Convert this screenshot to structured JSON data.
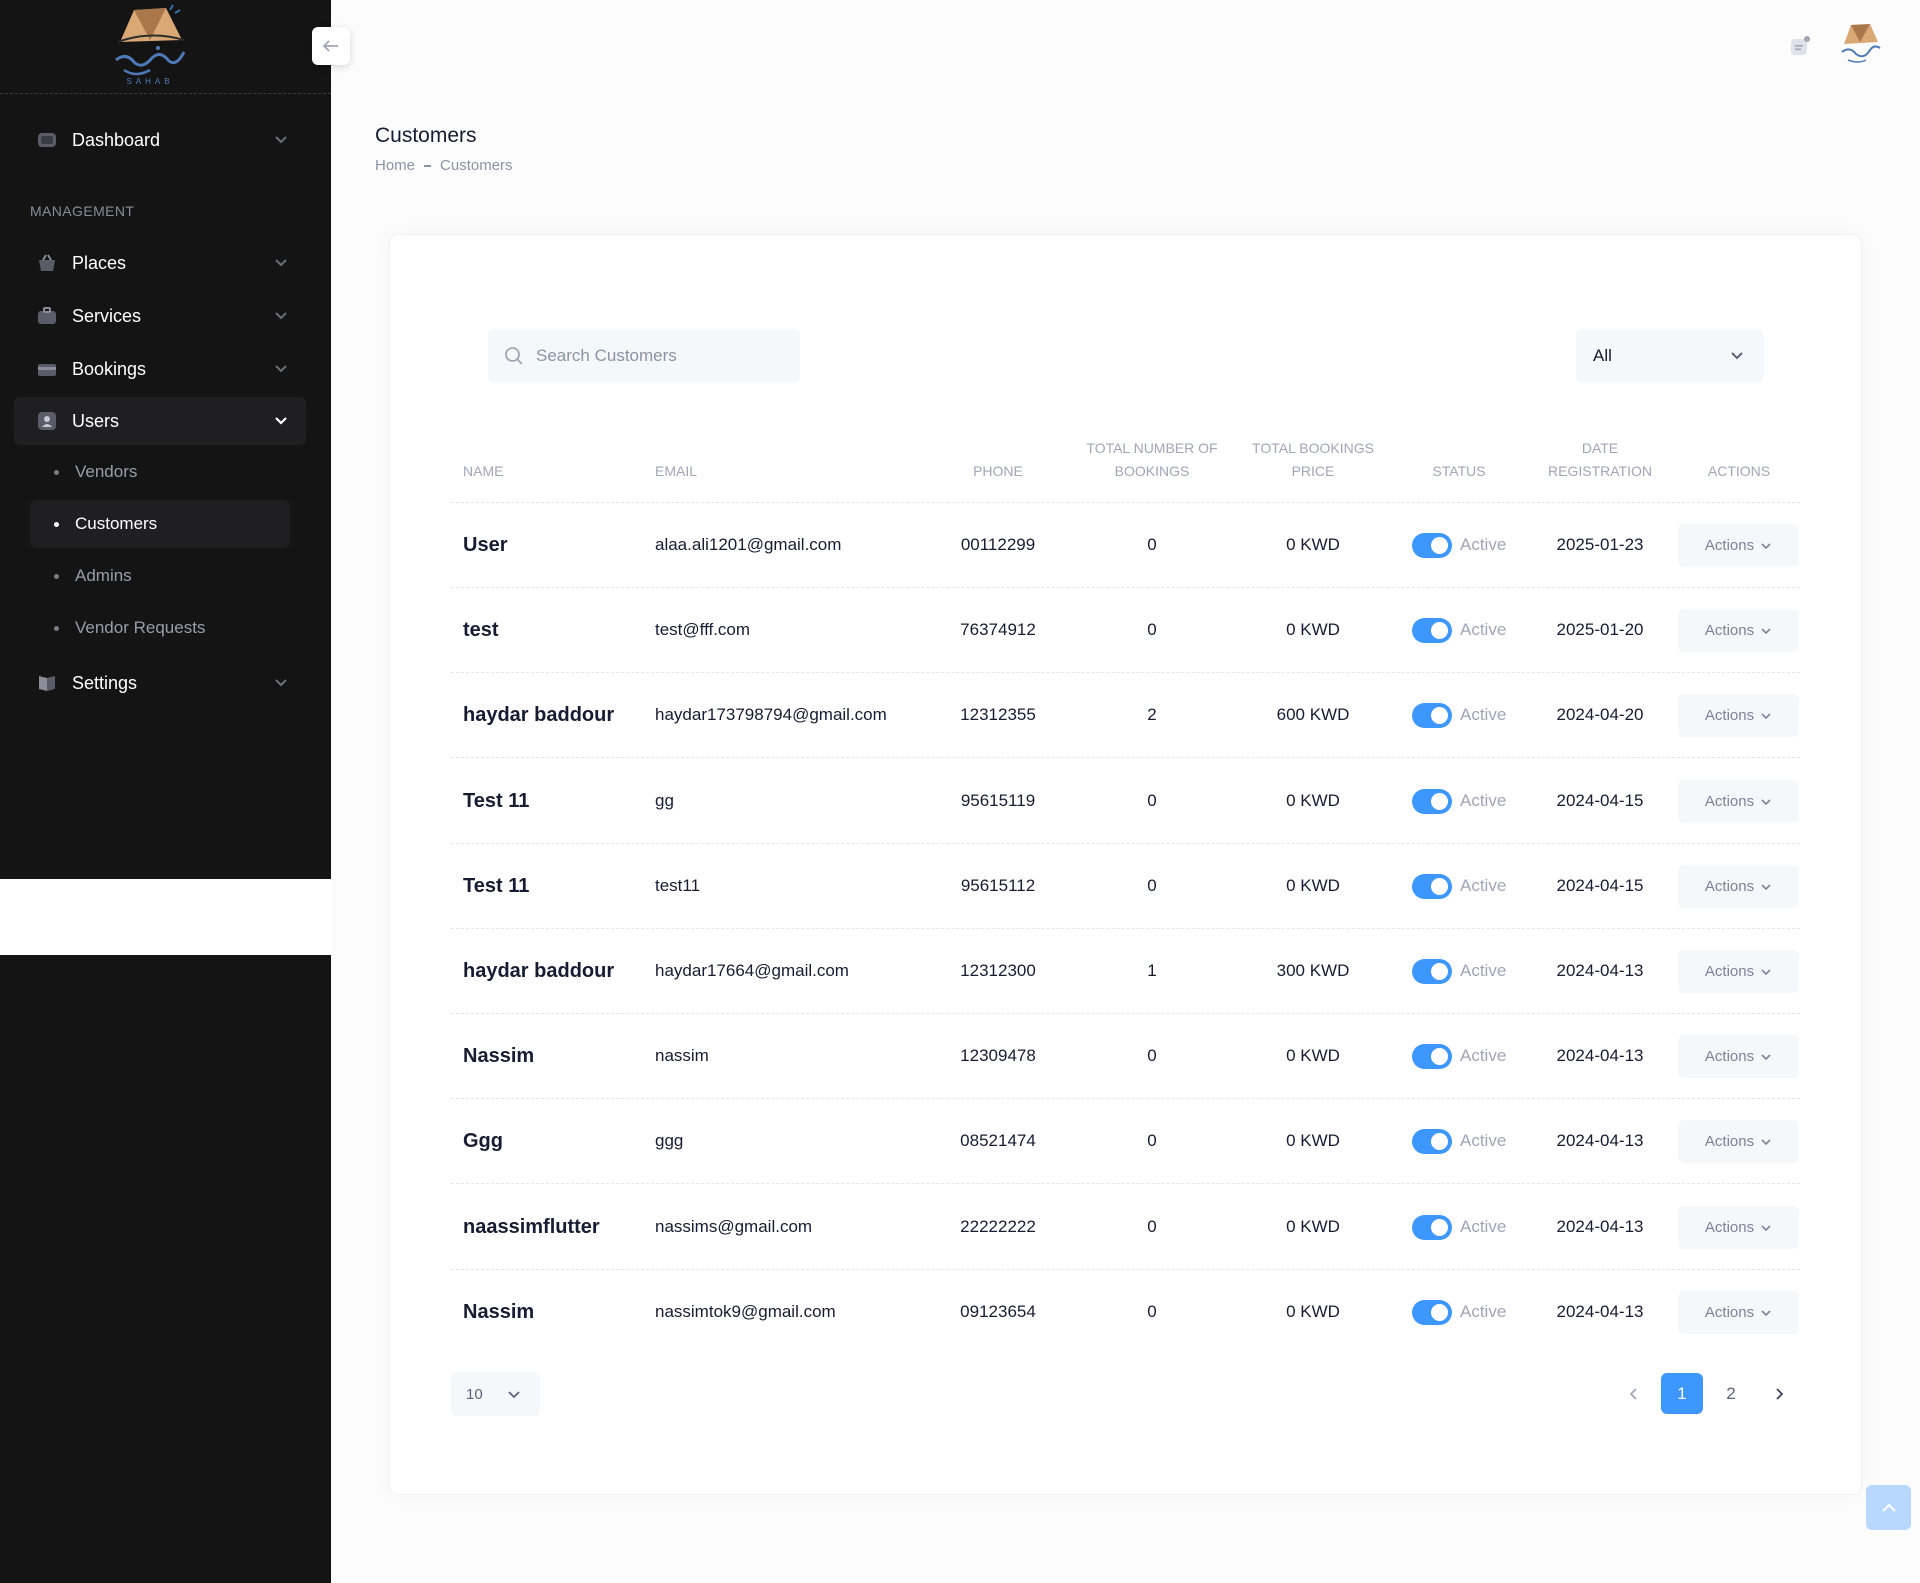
{
  "brand": {
    "logo_text": "سحاب",
    "logo_sub": "SAHAB"
  },
  "sidebar": {
    "section_label": "MANAGEMENT",
    "items": [
      {
        "label": "Dashboard",
        "icon": "dashboard-icon"
      },
      {
        "label": "Places",
        "icon": "basket-icon"
      },
      {
        "label": "Services",
        "icon": "briefcase-icon"
      },
      {
        "label": "Bookings",
        "icon": "wallet-icon"
      },
      {
        "label": "Users",
        "icon": "user-icon"
      },
      {
        "label": "Settings",
        "icon": "book-icon"
      }
    ],
    "users_sub": [
      {
        "label": "Vendors"
      },
      {
        "label": "Customers"
      },
      {
        "label": "Admins"
      },
      {
        "label": "Vendor Requests"
      }
    ]
  },
  "page": {
    "title": "Customers",
    "breadcrumb": [
      "Home",
      "Customers"
    ]
  },
  "search": {
    "placeholder": "Search Customers"
  },
  "filter": {
    "selected": "All"
  },
  "table": {
    "headers": {
      "name": "NAME",
      "email": "EMAIL",
      "phone": "PHONE",
      "bookings_l1": "TOTAL NUMBER OF",
      "bookings_l2": "BOOKINGS",
      "price_l1": "TOTAL BOOKINGS",
      "price_l2": "PRICE",
      "status": "STATUS",
      "date_l1": "DATE",
      "date_l2": "REGISTRATION",
      "actions": "ACTIONS"
    },
    "rows": [
      {
        "name": "User",
        "email": "alaa.ali1201@gmail.com",
        "phone": "00112299",
        "bookings": "0",
        "price": "0 KWD",
        "status": "Active",
        "date": "2025-01-23",
        "action": "Actions"
      },
      {
        "name": "test",
        "email": "test@fff.com",
        "phone": "76374912",
        "bookings": "0",
        "price": "0 KWD",
        "status": "Active",
        "date": "2025-01-20",
        "action": "Actions"
      },
      {
        "name": "haydar baddour",
        "email": "haydar173798794@gmail.com",
        "phone": "12312355",
        "bookings": "2",
        "price": "600 KWD",
        "status": "Active",
        "date": "2024-04-20",
        "action": "Actions"
      },
      {
        "name": "Test 11",
        "email": "gg",
        "phone": "95615119",
        "bookings": "0",
        "price": "0 KWD",
        "status": "Active",
        "date": "2024-04-15",
        "action": "Actions"
      },
      {
        "name": "Test 11",
        "email": "test11",
        "phone": "95615112",
        "bookings": "0",
        "price": "0 KWD",
        "status": "Active",
        "date": "2024-04-15",
        "action": "Actions"
      },
      {
        "name": "haydar baddour",
        "email": "haydar17664@gmail.com",
        "phone": "12312300",
        "bookings": "1",
        "price": "300 KWD",
        "status": "Active",
        "date": "2024-04-13",
        "action": "Actions"
      },
      {
        "name": "Nassim",
        "email": "nassim",
        "phone": "12309478",
        "bookings": "0",
        "price": "0 KWD",
        "status": "Active",
        "date": "2024-04-13",
        "action": "Actions"
      },
      {
        "name": "Ggg",
        "email": "ggg",
        "phone": "08521474",
        "bookings": "0",
        "price": "0 KWD",
        "status": "Active",
        "date": "2024-04-13",
        "action": "Actions"
      },
      {
        "name": "naassimflutter",
        "email": "nassims@gmail.com",
        "phone": "22222222",
        "bookings": "0",
        "price": "0 KWD",
        "status": "Active",
        "date": "2024-04-13",
        "action": "Actions"
      },
      {
        "name": "Nassim",
        "email": "nassimtok9@gmail.com",
        "phone": "09123654",
        "bookings": "0",
        "price": "0 KWD",
        "status": "Active",
        "date": "2024-04-13",
        "action": "Actions"
      }
    ]
  },
  "pagination": {
    "page_size": "10",
    "pages": [
      "1",
      "2"
    ],
    "current": "1"
  },
  "colors": {
    "primary": "#3e97ff",
    "sidebar_bg": "#141414",
    "muted": "#a1a5b7"
  }
}
